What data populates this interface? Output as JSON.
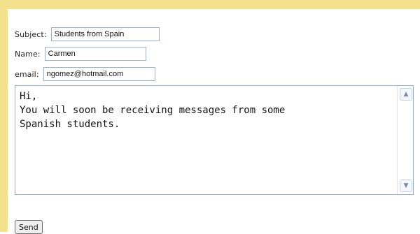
{
  "form": {
    "subject_label": "Subject:",
    "subject_value": "Students from Spain",
    "name_label": "Name:",
    "name_value": "Carmen",
    "email_label": "email:",
    "email_value": "ngomez@hotmail.com",
    "message_text": "Hi,\nYou will soon be receiving messages from some\nSpanish students.",
    "send_label": "Send"
  },
  "colors": {
    "border_highlight": "#f3e08a",
    "field_border": "#9ab0cf"
  },
  "icons": {
    "scroll_up": "chevron-up-icon",
    "scroll_down": "chevron-down-icon"
  }
}
